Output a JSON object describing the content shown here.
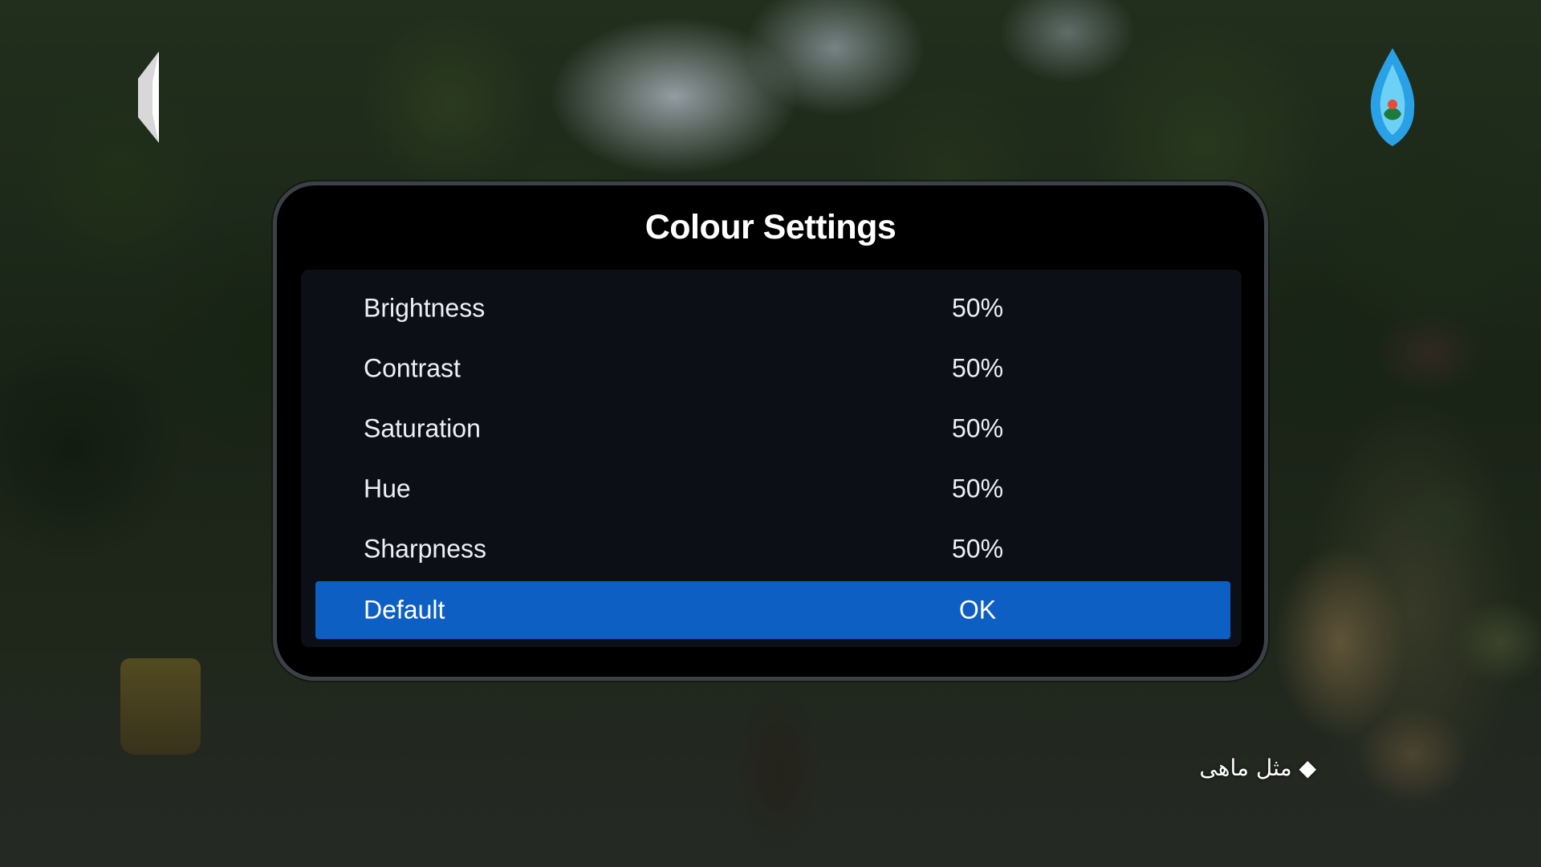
{
  "dialog": {
    "title": "Colour Settings"
  },
  "settings": [
    {
      "label": "Brightness",
      "value": "50%"
    },
    {
      "label": "Contrast",
      "value": "50%"
    },
    {
      "label": "Saturation",
      "value": "50%"
    },
    {
      "label": "Hue",
      "value": "50%"
    },
    {
      "label": "Sharpness",
      "value": "50%"
    },
    {
      "label": "Default",
      "value": "OK",
      "selected": true
    }
  ],
  "overlay": {
    "caption": "◆ مثل ماهی"
  },
  "colors": {
    "selection": "#0d5fc4",
    "dialog_bg": "#000000",
    "panel_bg": "#0d0f17",
    "text": "#eef0f4"
  },
  "icons": {
    "top_left": "channel-back-logo-icon",
    "top_right": "channel-logo-icon"
  }
}
